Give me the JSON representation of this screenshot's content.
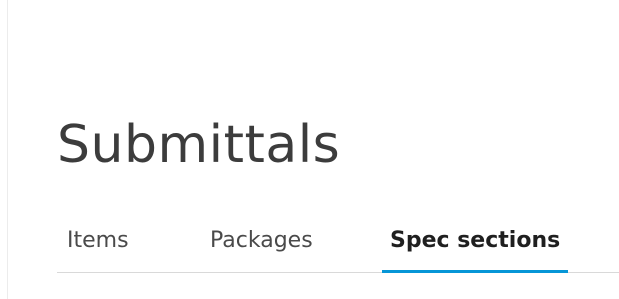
{
  "page": {
    "title": "Submittals"
  },
  "tabs": [
    {
      "label": "Items",
      "active": false
    },
    {
      "label": "Packages",
      "active": false
    },
    {
      "label": "Spec sections",
      "active": true
    }
  ],
  "colors": {
    "accent": "#0696d7",
    "title_text": "#3c3c3c",
    "tab_text": "#4a4a4a",
    "active_tab_text": "#1f1f1f",
    "divider": "#d9d9d9"
  }
}
